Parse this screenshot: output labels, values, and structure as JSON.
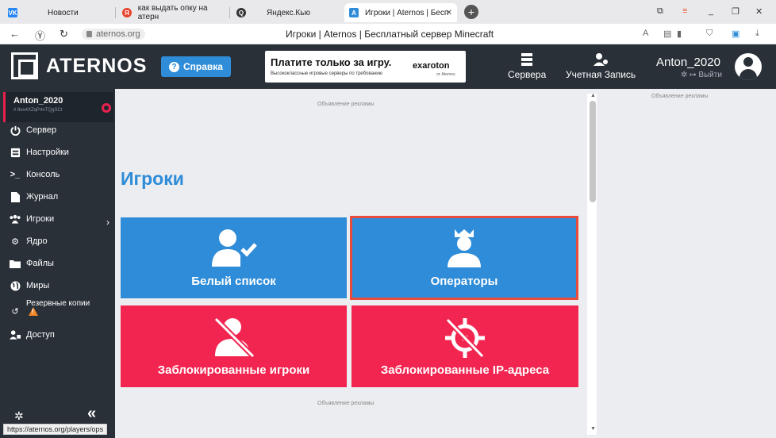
{
  "browser": {
    "tabs": [
      {
        "label": "Новости",
        "fav": "VK"
      },
      {
        "label": "как выдать опку на атерн",
        "fav": "Я"
      },
      {
        "label": "Яндекс.Кью",
        "fav": "Q"
      },
      {
        "label": "Игроки | Aternos | Бесп",
        "fav": "A"
      }
    ],
    "url": "aternos.org",
    "page_title": "Игроки | Aternos | Бесплатный сервер Minecraft",
    "status_url": "https://aternos.org/players/ops"
  },
  "header": {
    "logo": "ATERNOS",
    "help_label": "Справка",
    "ad": {
      "headline": "Платите только за игру.",
      "subline": "Высококлассные игровые серверы по требованию",
      "brand": "exaroton",
      "brand_sub": "от Aternos"
    },
    "servers_label": "Сервера",
    "account_label": "Учетная Запись",
    "user_name": "Anton_2020",
    "logout_label": "Выйти"
  },
  "sidebar": {
    "server_name": "Anton_2020",
    "server_id": "# 8es4XZqP4nTQgSCt",
    "items": [
      {
        "label": "Сервер",
        "icon": "power-icon"
      },
      {
        "label": "Настройки",
        "icon": "settings-icon"
      },
      {
        "label": "Консоль",
        "icon": "console-icon"
      },
      {
        "label": "Журнал",
        "icon": "log-icon"
      },
      {
        "label": "Игроки",
        "icon": "players-icon"
      },
      {
        "label": "Ядро",
        "icon": "core-icon"
      },
      {
        "label": "Файлы",
        "icon": "folder-icon"
      },
      {
        "label": "Миры",
        "icon": "globe-icon"
      },
      {
        "label": "Резервные копии",
        "icon": "backup-icon"
      },
      {
        "label": "Доступ",
        "icon": "access-icon"
      }
    ]
  },
  "main": {
    "ad_label": "Объявление рекламы",
    "title": "Игроки",
    "cards": [
      {
        "label": "Белый список",
        "icon": "user-check-icon"
      },
      {
        "label": "Операторы",
        "icon": "operator-crown-icon"
      },
      {
        "label": "Заблокированные игроки",
        "icon": "user-banned-icon"
      },
      {
        "label": "Заблокированные IP-адреса",
        "icon": "ip-banned-icon"
      }
    ]
  },
  "colors": {
    "header_bg": "#293038",
    "accent_blue": "#2e8cd8",
    "accent_red": "#f22550",
    "selected_border": "#e74c3c"
  }
}
